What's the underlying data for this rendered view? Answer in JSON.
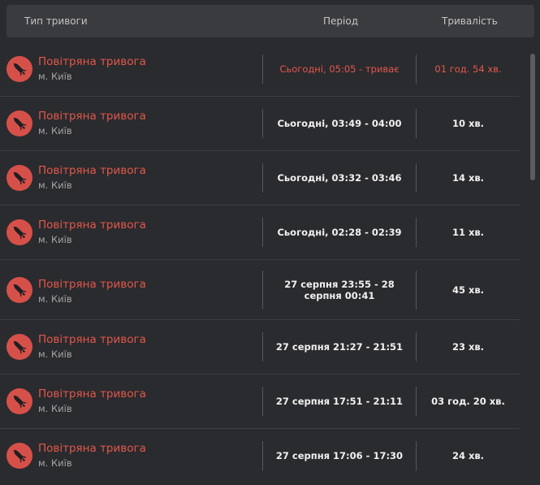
{
  "header": {
    "type_label": "Тип тривоги",
    "period_label": "Період",
    "duration_label": "Тривалість"
  },
  "icon": "missile-icon",
  "colors": {
    "accent": "#e2574c",
    "icon_bg": "#d6504a",
    "background": "#2a2b2e",
    "header_bg": "#3a3b3e"
  },
  "alerts": [
    {
      "title": "Повітряна тривога",
      "city": "м. Київ",
      "period": "Сьогодні, 05:05 - триває",
      "duration": "01 год. 54 хв.",
      "active": true
    },
    {
      "title": "Повітряна тривога",
      "city": "м. Київ",
      "period": "Сьогодні, 03:49 - 04:00",
      "duration": "10 хв.",
      "active": false
    },
    {
      "title": "Повітряна тривога",
      "city": "м. Київ",
      "period": "Сьогодні, 03:32 - 03:46",
      "duration": "14 хв.",
      "active": false
    },
    {
      "title": "Повітряна тривога",
      "city": "м. Київ",
      "period": "Сьогодні, 02:28 - 02:39",
      "duration": "11 хв.",
      "active": false
    },
    {
      "title": "Повітряна тривога",
      "city": "м. Київ",
      "period": "27 серпня 23:55 - 28 серпня 00:41",
      "duration": "45 хв.",
      "active": false
    },
    {
      "title": "Повітряна тривога",
      "city": "м. Київ",
      "period": "27 серпня 21:27 - 21:51",
      "duration": "23 хв.",
      "active": false
    },
    {
      "title": "Повітряна тривога",
      "city": "м. Київ",
      "period": "27 серпня 17:51 - 21:11",
      "duration": "03 год. 20 хв.",
      "active": false
    },
    {
      "title": "Повітряна тривога",
      "city": "м. Київ",
      "period": "27 серпня 17:06 - 17:30",
      "duration": "24 хв.",
      "active": false
    }
  ]
}
